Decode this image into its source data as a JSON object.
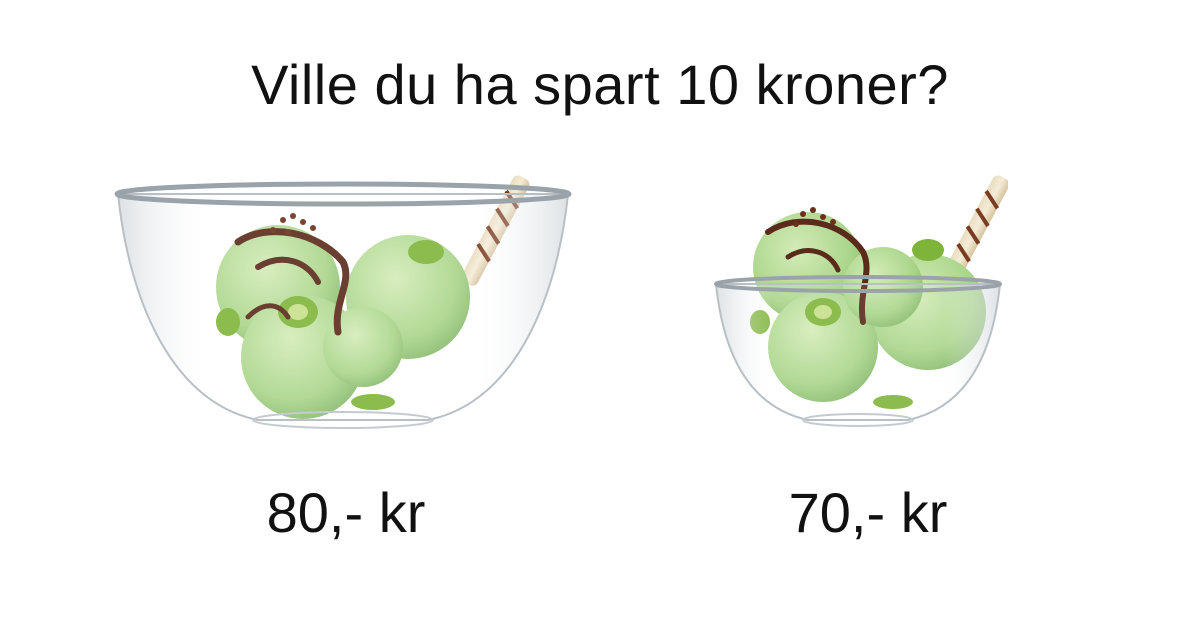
{
  "headline": "Ville du ha spart 10 kroner?",
  "offers": [
    {
      "price": "80,- kr",
      "icon": "large-ice-cream-bowl-icon"
    },
    {
      "price": "70,- kr",
      "icon": "small-ice-cream-bowl-icon"
    }
  ],
  "colors": {
    "text": "#111111",
    "ice_cream": "#a9d58a",
    "kiwi": "#7fb43a",
    "chocolate": "#5a2a1a",
    "glass": "#d9dde0"
  }
}
